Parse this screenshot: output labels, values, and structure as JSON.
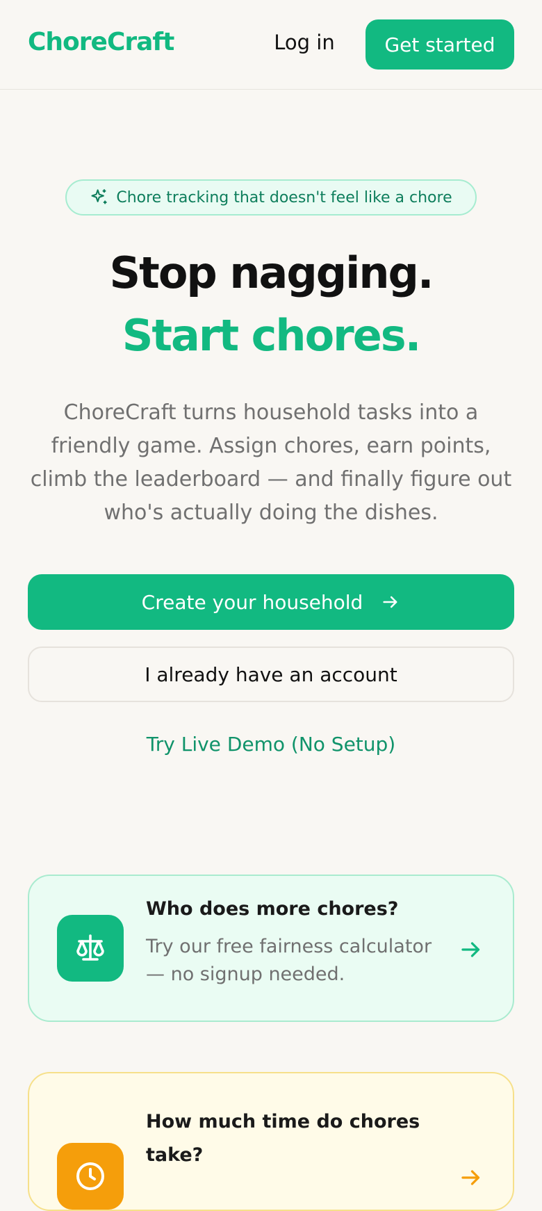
{
  "header": {
    "logo": "ChoreCraft",
    "login_label": "Log in",
    "cta_label": "Get started"
  },
  "hero": {
    "badge": "Chore tracking that doesn't feel like a chore",
    "title_line1": "Stop nagging.",
    "title_line2": "Start chores.",
    "lead": "ChoreCraft turns household tasks into a friendly game. Assign chores, earn points, climb the leaderboard — and finally figure out who's actually doing the dishes.",
    "primary_label": "Create your household",
    "secondary_label": "I already have an account",
    "demo_label": "Try Live Demo (No Setup)"
  },
  "cards": [
    {
      "title": "Who does more chores?",
      "desc": "Try our free fairness calculator — no signup needed.",
      "icon": "scale-icon"
    },
    {
      "title": "How much time do chores take?",
      "icon": "clock-icon"
    }
  ],
  "colors": {
    "brand": "#12b981",
    "background": "#f9f7f3",
    "accent_yellow": "#f59e0b"
  }
}
